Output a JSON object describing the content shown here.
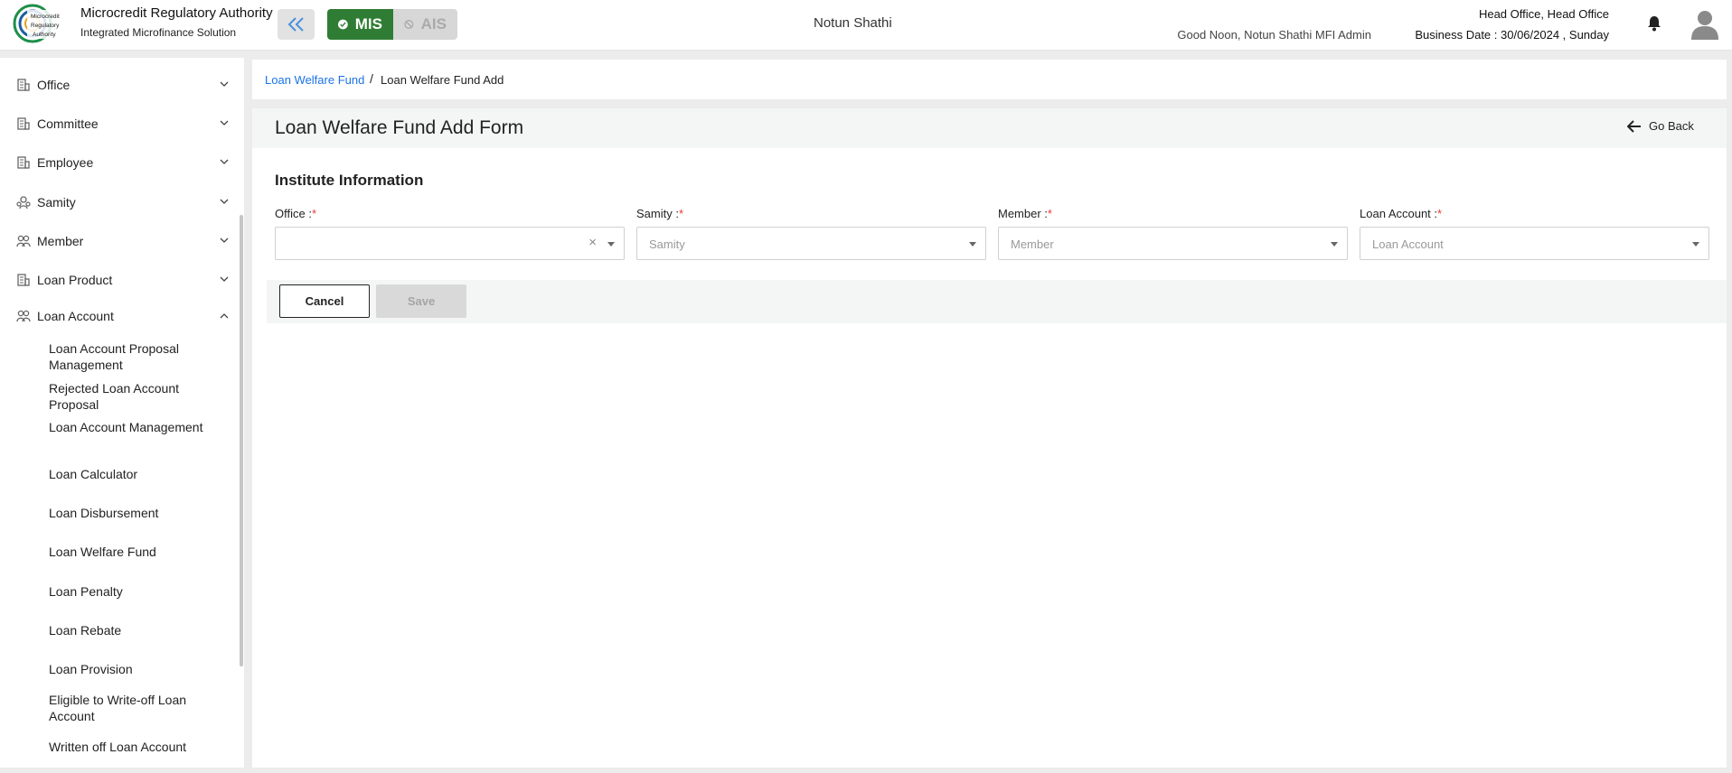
{
  "header": {
    "org_name": "Microcredit Regulatory Authority",
    "org_sub": "Integrated Microfinance Solution",
    "logo_text": "Microcredit Regulatory Authority",
    "modes": [
      {
        "label": "MIS",
        "icon": "check-circle-icon",
        "active": true
      },
      {
        "label": "AIS",
        "icon": "block-icon",
        "active": false
      }
    ],
    "center_title": "Notun Shathi",
    "greeting": "Good Noon, Notun Shathi MFI Admin",
    "office": "Head Office, Head Office",
    "business_date": "Business Date : 30/06/2024 , Sunday"
  },
  "sidebar": {
    "items": [
      {
        "label": "Office",
        "icon": "office-icon",
        "expanded": false
      },
      {
        "label": "Committee",
        "icon": "committee-icon",
        "expanded": false
      },
      {
        "label": "Employee",
        "icon": "employee-icon",
        "expanded": false
      },
      {
        "label": "Samity",
        "icon": "samity-icon",
        "expanded": false
      },
      {
        "label": "Member",
        "icon": "member-icon",
        "expanded": false
      },
      {
        "label": "Loan Product",
        "icon": "loan-product-icon",
        "expanded": false
      },
      {
        "label": "Loan Account",
        "icon": "loan-account-icon",
        "expanded": true
      }
    ],
    "sub_items": [
      "Loan Account Proposal Management",
      "Rejected Loan Account Proposal",
      "Loan Account Management",
      "Loan Calculator",
      "Loan Disbursement",
      "Loan Welfare Fund",
      "Loan Penalty",
      "Loan Rebate",
      "Loan Provision",
      "Eligible to Write-off Loan Account",
      "Written off Loan Account"
    ]
  },
  "breadcrumb": {
    "link": "Loan Welfare Fund",
    "separator": "/",
    "current": "Loan Welfare Fund Add"
  },
  "form": {
    "title": "Loan Welfare Fund Add Form",
    "go_back": "Go Back",
    "section_title": "Institute Information",
    "fields": [
      {
        "label": "Office :",
        "required_mark": "*",
        "placeholder": "",
        "clearable": true
      },
      {
        "label": "Samity :",
        "required_mark": "*",
        "placeholder": "Samity",
        "clearable": false
      },
      {
        "label": "Member :",
        "required_mark": "*",
        "placeholder": "Member",
        "clearable": false
      },
      {
        "label": "Loan Account :",
        "required_mark": "*",
        "placeholder": "Loan Account",
        "clearable": false
      }
    ],
    "clear_glyph": "×",
    "cancel_label": "Cancel",
    "save_label": "Save"
  },
  "colors": {
    "accent_green": "#2f7d34",
    "link_blue": "#1a73e8",
    "required_red": "#e53935"
  }
}
